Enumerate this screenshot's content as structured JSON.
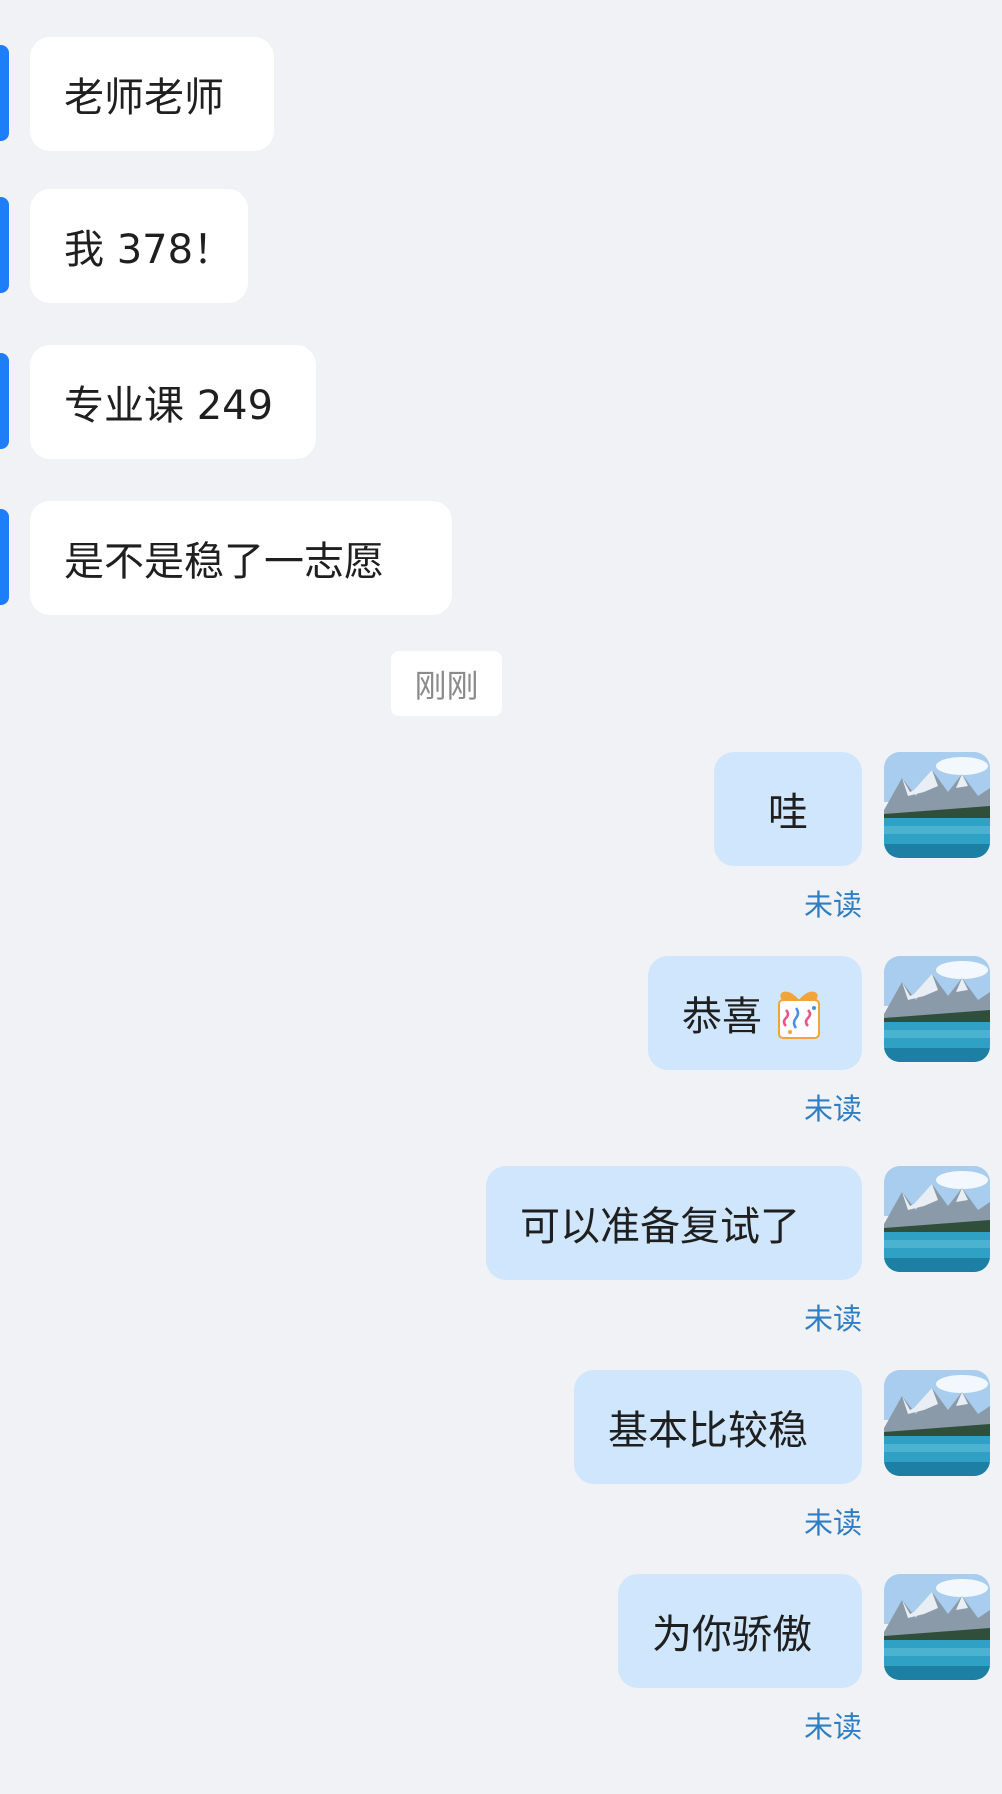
{
  "incoming_messages": [
    {
      "text": "老师老师"
    },
    {
      "text": "我 378！"
    },
    {
      "text": "专业课 249"
    },
    {
      "text": "是不是稳了一志愿"
    }
  ],
  "timestamp": "刚刚",
  "outgoing_messages": [
    {
      "text": "哇",
      "status": "未读"
    },
    {
      "text": "恭喜",
      "emoji": "gift-icon",
      "status": "未读"
    },
    {
      "text": "可以准备复试了",
      "status": "未读"
    },
    {
      "text": "基本比较稳",
      "status": "未读"
    },
    {
      "text": "为你骄傲",
      "status": "未读"
    }
  ],
  "colors": {
    "background": "#f0f2f5",
    "incoming_bubble": "#ffffff",
    "outgoing_bubble": "#cfe6fc",
    "unread_text": "#2f7ec4",
    "accent": "#1e7ef7"
  }
}
